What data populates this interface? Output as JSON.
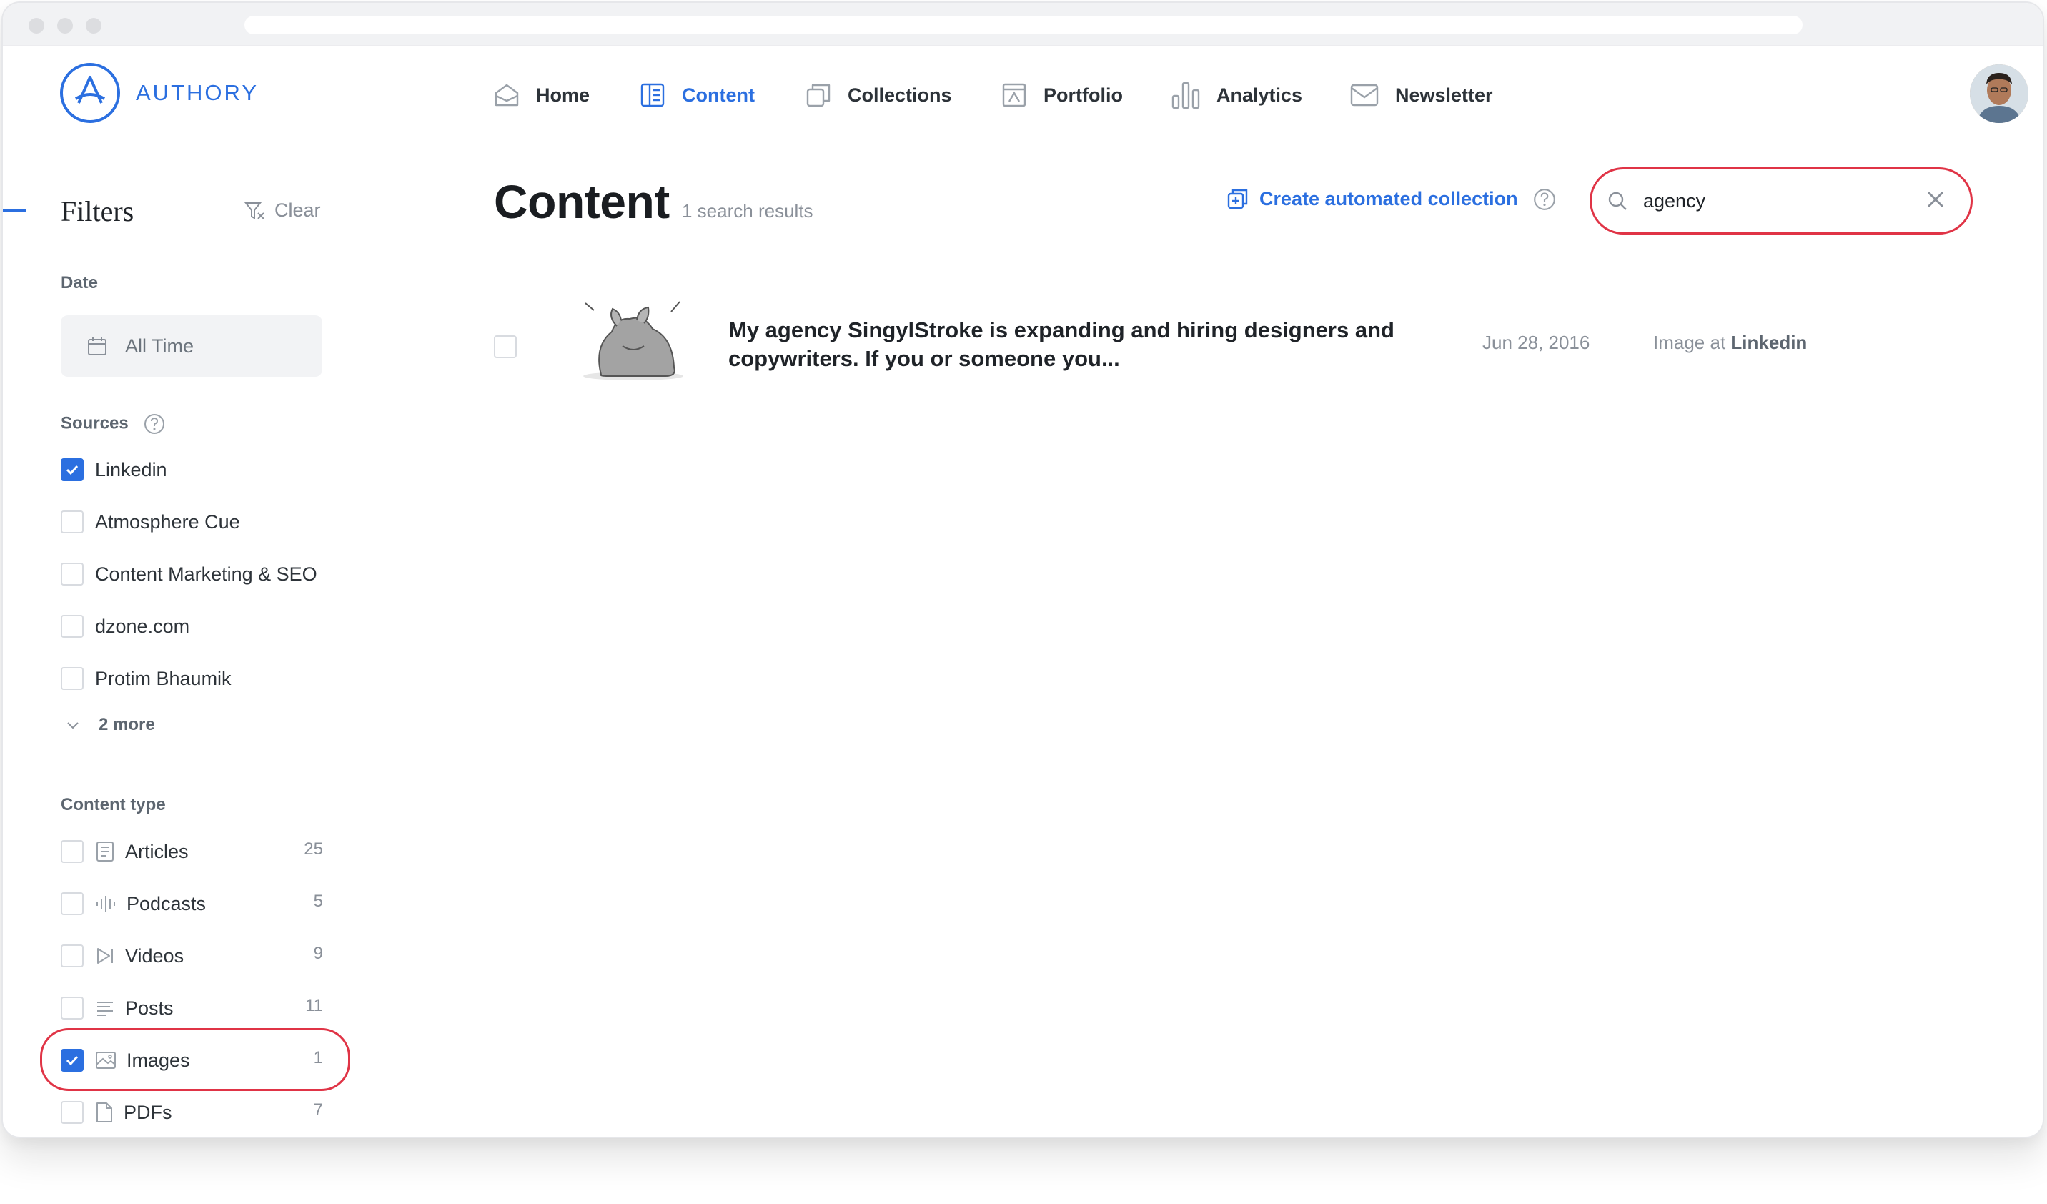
{
  "app": {
    "logo_text": "AUTHORY"
  },
  "nav": {
    "items": [
      {
        "label": "Home",
        "icon": "home-icon",
        "active": false
      },
      {
        "label": "Content",
        "icon": "content-icon",
        "active": true
      },
      {
        "label": "Collections",
        "icon": "collections-icon",
        "active": false
      },
      {
        "label": "Portfolio",
        "icon": "portfolio-icon",
        "active": false
      },
      {
        "label": "Analytics",
        "icon": "analytics-icon",
        "active": false
      },
      {
        "label": "Newsletter",
        "icon": "newsletter-icon",
        "active": false
      }
    ]
  },
  "filters": {
    "title": "Filters",
    "clear_label": "Clear",
    "date": {
      "label": "Date",
      "value": "All Time"
    },
    "sources": {
      "label": "Sources",
      "items": [
        {
          "label": "Linkedin",
          "checked": true
        },
        {
          "label": "Atmosphere Cue",
          "checked": false
        },
        {
          "label": "Content Marketing & SEO",
          "checked": false
        },
        {
          "label": "dzone.com",
          "checked": false
        },
        {
          "label": "Protim Bhaumik",
          "checked": false
        }
      ],
      "more_label": "2 more"
    },
    "content_type": {
      "label": "Content type",
      "items": [
        {
          "label": "Articles",
          "count": "25",
          "checked": false,
          "icon": "article-icon"
        },
        {
          "label": "Podcasts",
          "count": "5",
          "checked": false,
          "icon": "podcast-icon"
        },
        {
          "label": "Videos",
          "count": "9",
          "checked": false,
          "icon": "video-icon"
        },
        {
          "label": "Posts",
          "count": "11",
          "checked": false,
          "icon": "post-icon"
        },
        {
          "label": "Images",
          "count": "1",
          "checked": true,
          "icon": "image-icon"
        },
        {
          "label": "PDFs",
          "count": "7",
          "checked": false,
          "icon": "pdf-icon"
        }
      ]
    }
  },
  "main": {
    "title": "Content",
    "results_count": "1 search results",
    "create_collection_label": "Create automated collection",
    "search": {
      "value": "agency",
      "placeholder": "Search"
    },
    "results": [
      {
        "title": "My agency SingylStroke is expanding and hiring designers and copywriters. If you or someone you...",
        "date": "Jun 28, 2016",
        "type_prefix": "Image at",
        "source": "Linkedin"
      }
    ]
  },
  "colors": {
    "accent": "#2b6fe0",
    "highlight": "#e03446",
    "muted": "#8a9099"
  }
}
